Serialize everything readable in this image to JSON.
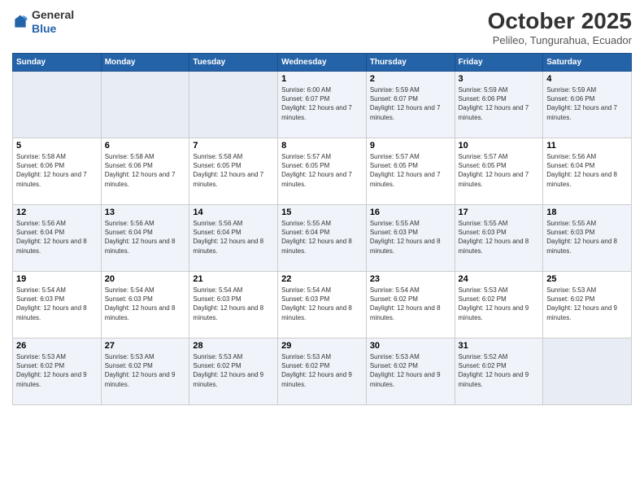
{
  "header": {
    "logo": {
      "general": "General",
      "blue": "Blue"
    },
    "title": "October 2025",
    "subtitle": "Pelileo, Tungurahua, Ecuador"
  },
  "weekdays": [
    "Sunday",
    "Monday",
    "Tuesday",
    "Wednesday",
    "Thursday",
    "Friday",
    "Saturday"
  ],
  "weeks": [
    [
      {
        "day": "",
        "empty": true
      },
      {
        "day": "",
        "empty": true
      },
      {
        "day": "",
        "empty": true
      },
      {
        "day": "1",
        "sunrise": "Sunrise: 6:00 AM",
        "sunset": "Sunset: 6:07 PM",
        "daylight": "Daylight: 12 hours and 7 minutes."
      },
      {
        "day": "2",
        "sunrise": "Sunrise: 5:59 AM",
        "sunset": "Sunset: 6:07 PM",
        "daylight": "Daylight: 12 hours and 7 minutes."
      },
      {
        "day": "3",
        "sunrise": "Sunrise: 5:59 AM",
        "sunset": "Sunset: 6:06 PM",
        "daylight": "Daylight: 12 hours and 7 minutes."
      },
      {
        "day": "4",
        "sunrise": "Sunrise: 5:59 AM",
        "sunset": "Sunset: 6:06 PM",
        "daylight": "Daylight: 12 hours and 7 minutes."
      }
    ],
    [
      {
        "day": "5",
        "sunrise": "Sunrise: 5:58 AM",
        "sunset": "Sunset: 6:06 PM",
        "daylight": "Daylight: 12 hours and 7 minutes."
      },
      {
        "day": "6",
        "sunrise": "Sunrise: 5:58 AM",
        "sunset": "Sunset: 6:06 PM",
        "daylight": "Daylight: 12 hours and 7 minutes."
      },
      {
        "day": "7",
        "sunrise": "Sunrise: 5:58 AM",
        "sunset": "Sunset: 6:05 PM",
        "daylight": "Daylight: 12 hours and 7 minutes."
      },
      {
        "day": "8",
        "sunrise": "Sunrise: 5:57 AM",
        "sunset": "Sunset: 6:05 PM",
        "daylight": "Daylight: 12 hours and 7 minutes."
      },
      {
        "day": "9",
        "sunrise": "Sunrise: 5:57 AM",
        "sunset": "Sunset: 6:05 PM",
        "daylight": "Daylight: 12 hours and 7 minutes."
      },
      {
        "day": "10",
        "sunrise": "Sunrise: 5:57 AM",
        "sunset": "Sunset: 6:05 PM",
        "daylight": "Daylight: 12 hours and 7 minutes."
      },
      {
        "day": "11",
        "sunrise": "Sunrise: 5:56 AM",
        "sunset": "Sunset: 6:04 PM",
        "daylight": "Daylight: 12 hours and 8 minutes."
      }
    ],
    [
      {
        "day": "12",
        "sunrise": "Sunrise: 5:56 AM",
        "sunset": "Sunset: 6:04 PM",
        "daylight": "Daylight: 12 hours and 8 minutes."
      },
      {
        "day": "13",
        "sunrise": "Sunrise: 5:56 AM",
        "sunset": "Sunset: 6:04 PM",
        "daylight": "Daylight: 12 hours and 8 minutes."
      },
      {
        "day": "14",
        "sunrise": "Sunrise: 5:56 AM",
        "sunset": "Sunset: 6:04 PM",
        "daylight": "Daylight: 12 hours and 8 minutes."
      },
      {
        "day": "15",
        "sunrise": "Sunrise: 5:55 AM",
        "sunset": "Sunset: 6:04 PM",
        "daylight": "Daylight: 12 hours and 8 minutes."
      },
      {
        "day": "16",
        "sunrise": "Sunrise: 5:55 AM",
        "sunset": "Sunset: 6:03 PM",
        "daylight": "Daylight: 12 hours and 8 minutes."
      },
      {
        "day": "17",
        "sunrise": "Sunrise: 5:55 AM",
        "sunset": "Sunset: 6:03 PM",
        "daylight": "Daylight: 12 hours and 8 minutes."
      },
      {
        "day": "18",
        "sunrise": "Sunrise: 5:55 AM",
        "sunset": "Sunset: 6:03 PM",
        "daylight": "Daylight: 12 hours and 8 minutes."
      }
    ],
    [
      {
        "day": "19",
        "sunrise": "Sunrise: 5:54 AM",
        "sunset": "Sunset: 6:03 PM",
        "daylight": "Daylight: 12 hours and 8 minutes."
      },
      {
        "day": "20",
        "sunrise": "Sunrise: 5:54 AM",
        "sunset": "Sunset: 6:03 PM",
        "daylight": "Daylight: 12 hours and 8 minutes."
      },
      {
        "day": "21",
        "sunrise": "Sunrise: 5:54 AM",
        "sunset": "Sunset: 6:03 PM",
        "daylight": "Daylight: 12 hours and 8 minutes."
      },
      {
        "day": "22",
        "sunrise": "Sunrise: 5:54 AM",
        "sunset": "Sunset: 6:03 PM",
        "daylight": "Daylight: 12 hours and 8 minutes."
      },
      {
        "day": "23",
        "sunrise": "Sunrise: 5:54 AM",
        "sunset": "Sunset: 6:02 PM",
        "daylight": "Daylight: 12 hours and 8 minutes."
      },
      {
        "day": "24",
        "sunrise": "Sunrise: 5:53 AM",
        "sunset": "Sunset: 6:02 PM",
        "daylight": "Daylight: 12 hours and 9 minutes."
      },
      {
        "day": "25",
        "sunrise": "Sunrise: 5:53 AM",
        "sunset": "Sunset: 6:02 PM",
        "daylight": "Daylight: 12 hours and 9 minutes."
      }
    ],
    [
      {
        "day": "26",
        "sunrise": "Sunrise: 5:53 AM",
        "sunset": "Sunset: 6:02 PM",
        "daylight": "Daylight: 12 hours and 9 minutes."
      },
      {
        "day": "27",
        "sunrise": "Sunrise: 5:53 AM",
        "sunset": "Sunset: 6:02 PM",
        "daylight": "Daylight: 12 hours and 9 minutes."
      },
      {
        "day": "28",
        "sunrise": "Sunrise: 5:53 AM",
        "sunset": "Sunset: 6:02 PM",
        "daylight": "Daylight: 12 hours and 9 minutes."
      },
      {
        "day": "29",
        "sunrise": "Sunrise: 5:53 AM",
        "sunset": "Sunset: 6:02 PM",
        "daylight": "Daylight: 12 hours and 9 minutes."
      },
      {
        "day": "30",
        "sunrise": "Sunrise: 5:53 AM",
        "sunset": "Sunset: 6:02 PM",
        "daylight": "Daylight: 12 hours and 9 minutes."
      },
      {
        "day": "31",
        "sunrise": "Sunrise: 5:52 AM",
        "sunset": "Sunset: 6:02 PM",
        "daylight": "Daylight: 12 hours and 9 minutes."
      },
      {
        "day": "",
        "empty": true
      }
    ]
  ]
}
